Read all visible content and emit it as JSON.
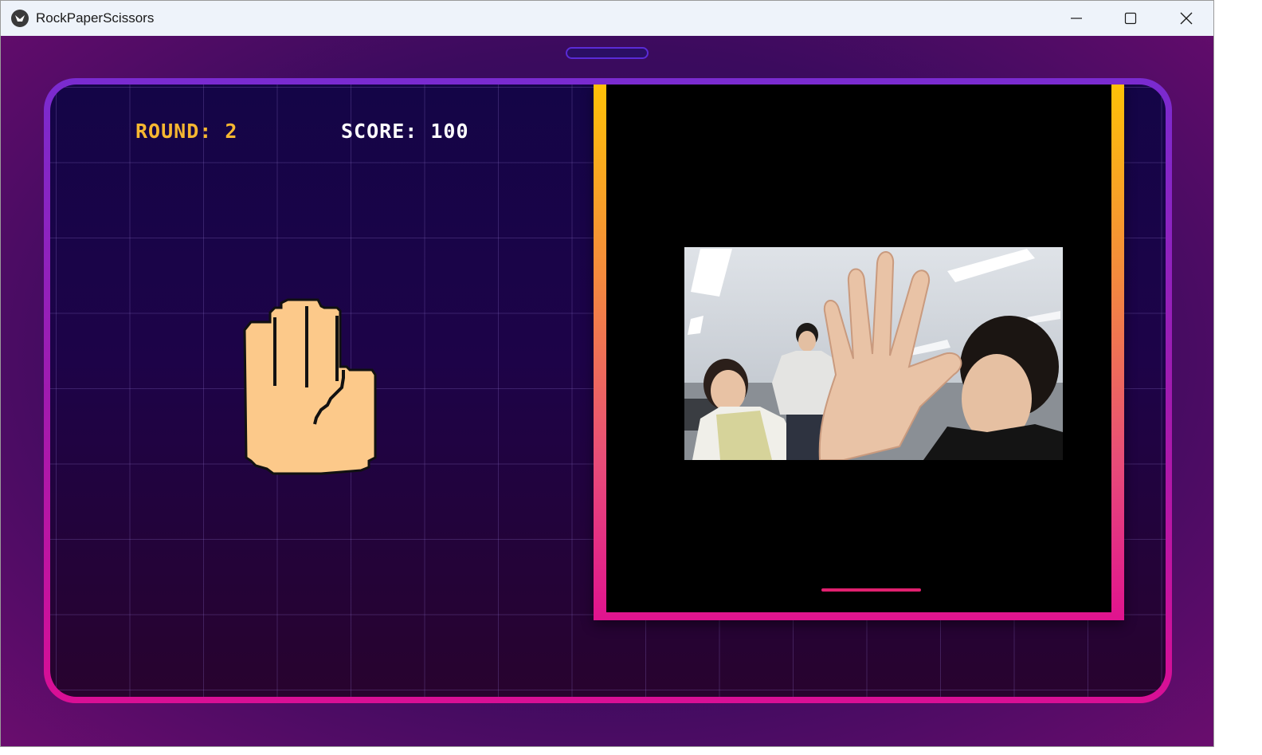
{
  "window": {
    "title": "RockPaperScissors",
    "controls": [
      "minimize-icon",
      "maximize-icon",
      "close-icon"
    ]
  },
  "hud": {
    "round_label": "ROUND: 2",
    "score_label": "SCORE: 100"
  },
  "computer_move": {
    "icon": "paper-hand-icon",
    "color": "#fcc98a"
  },
  "camera": {
    "feed": "webcam-feed"
  },
  "colors": {
    "round": "#f7b731",
    "score": "#ffffff",
    "frame_top": "#ffc107",
    "frame_bottom": "#e0138f"
  }
}
